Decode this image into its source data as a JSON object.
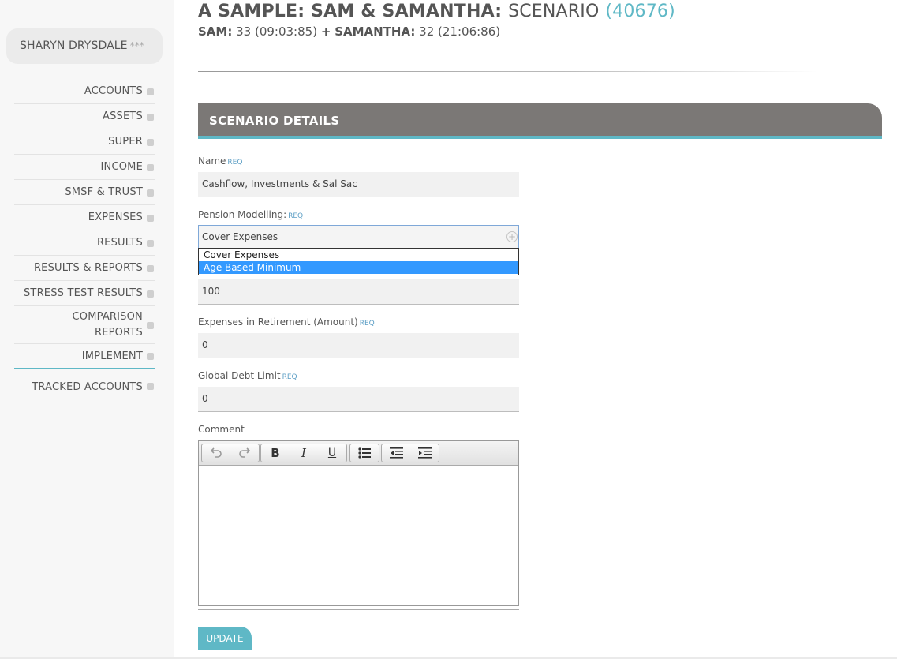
{
  "sidebar": {
    "user_name": "SHARYN DRYSDALE",
    "user_stars": "***",
    "nav": [
      {
        "label": "ACCOUNTS"
      },
      {
        "label": "ASSETS"
      },
      {
        "label": "SUPER"
      },
      {
        "label": "INCOME"
      },
      {
        "label": "SMSF & TRUST"
      },
      {
        "label": "EXPENSES"
      },
      {
        "label": "RESULTS"
      },
      {
        "label": "RESULTS & REPORTS"
      },
      {
        "label": "STRESS TEST RESULTS"
      },
      {
        "label_line1": "COMPARISON",
        "label_line2": "REPORTS"
      },
      {
        "label": "IMPLEMENT"
      },
      {
        "label": "TRACKED ACCOUNTS"
      }
    ]
  },
  "header": {
    "title_bold": "A SAMPLE: SAM & SAMANTHA:",
    "title_plain": "SCENARIO",
    "title_id": "(40676)",
    "person1_name": "SAM:",
    "person1_info": "33 (09:03:85)",
    "plus": "+",
    "person2_name": "SAMANTHA:",
    "person2_info": "32 (21:06:86)"
  },
  "section": {
    "title": "SCENARIO DETAILS"
  },
  "form": {
    "req_tag": "REQ",
    "name_label": "Name",
    "name_value": "Cashflow, Investments & Sal Sac",
    "pension_label": "Pension Modelling:",
    "pension_value": "Cover Expenses",
    "pension_options": [
      "Cover Expenses",
      "Age Based Minimum"
    ],
    "hidden_field_value": "100",
    "expenses_label": "Expenses in Retirement (Amount)",
    "expenses_value": "0",
    "debt_label": "Global Debt Limit",
    "debt_value": "0",
    "comment_label": "Comment",
    "update_label": "UPDATE"
  },
  "colors": {
    "accent": "#5fb8c6",
    "section_header": "#7b7876",
    "dropdown_selected": "#3399ff"
  }
}
